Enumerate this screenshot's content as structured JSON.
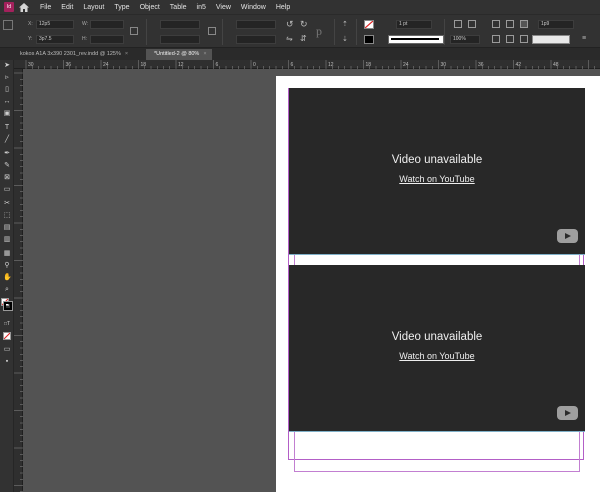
{
  "menubar": {
    "app_badge": "Id",
    "items": [
      "File",
      "Edit",
      "Layout",
      "Type",
      "Object",
      "Table",
      "in5",
      "View",
      "Window",
      "Help"
    ]
  },
  "control": {
    "x_label": "X:",
    "x_value": "12p5",
    "y_label": "Y:",
    "y_value": "3p7.5",
    "w_label": "W:",
    "h_label": "H:",
    "stroke_weight": "1 pt",
    "opacity": "100%",
    "size_value": "1p9"
  },
  "tabs": [
    {
      "label": "kokos A1A 3x390 2301_rev.indd @ 125%",
      "close": "×"
    },
    {
      "label": "*Untitled-2 @ 80%",
      "close": "×"
    }
  ],
  "ruler_labels": [
    "30",
    "36",
    "24",
    "18",
    "12",
    "6",
    "0",
    "6",
    "12",
    "18",
    "24",
    "30",
    "36",
    "42",
    "48"
  ],
  "videos": [
    {
      "title": "Video unavailable",
      "link": "Watch on YouTube",
      "icon": "youtube-play-icon"
    },
    {
      "title": "Video unavailable",
      "link": "Watch on YouTube",
      "icon": "youtube-play-icon"
    }
  ]
}
